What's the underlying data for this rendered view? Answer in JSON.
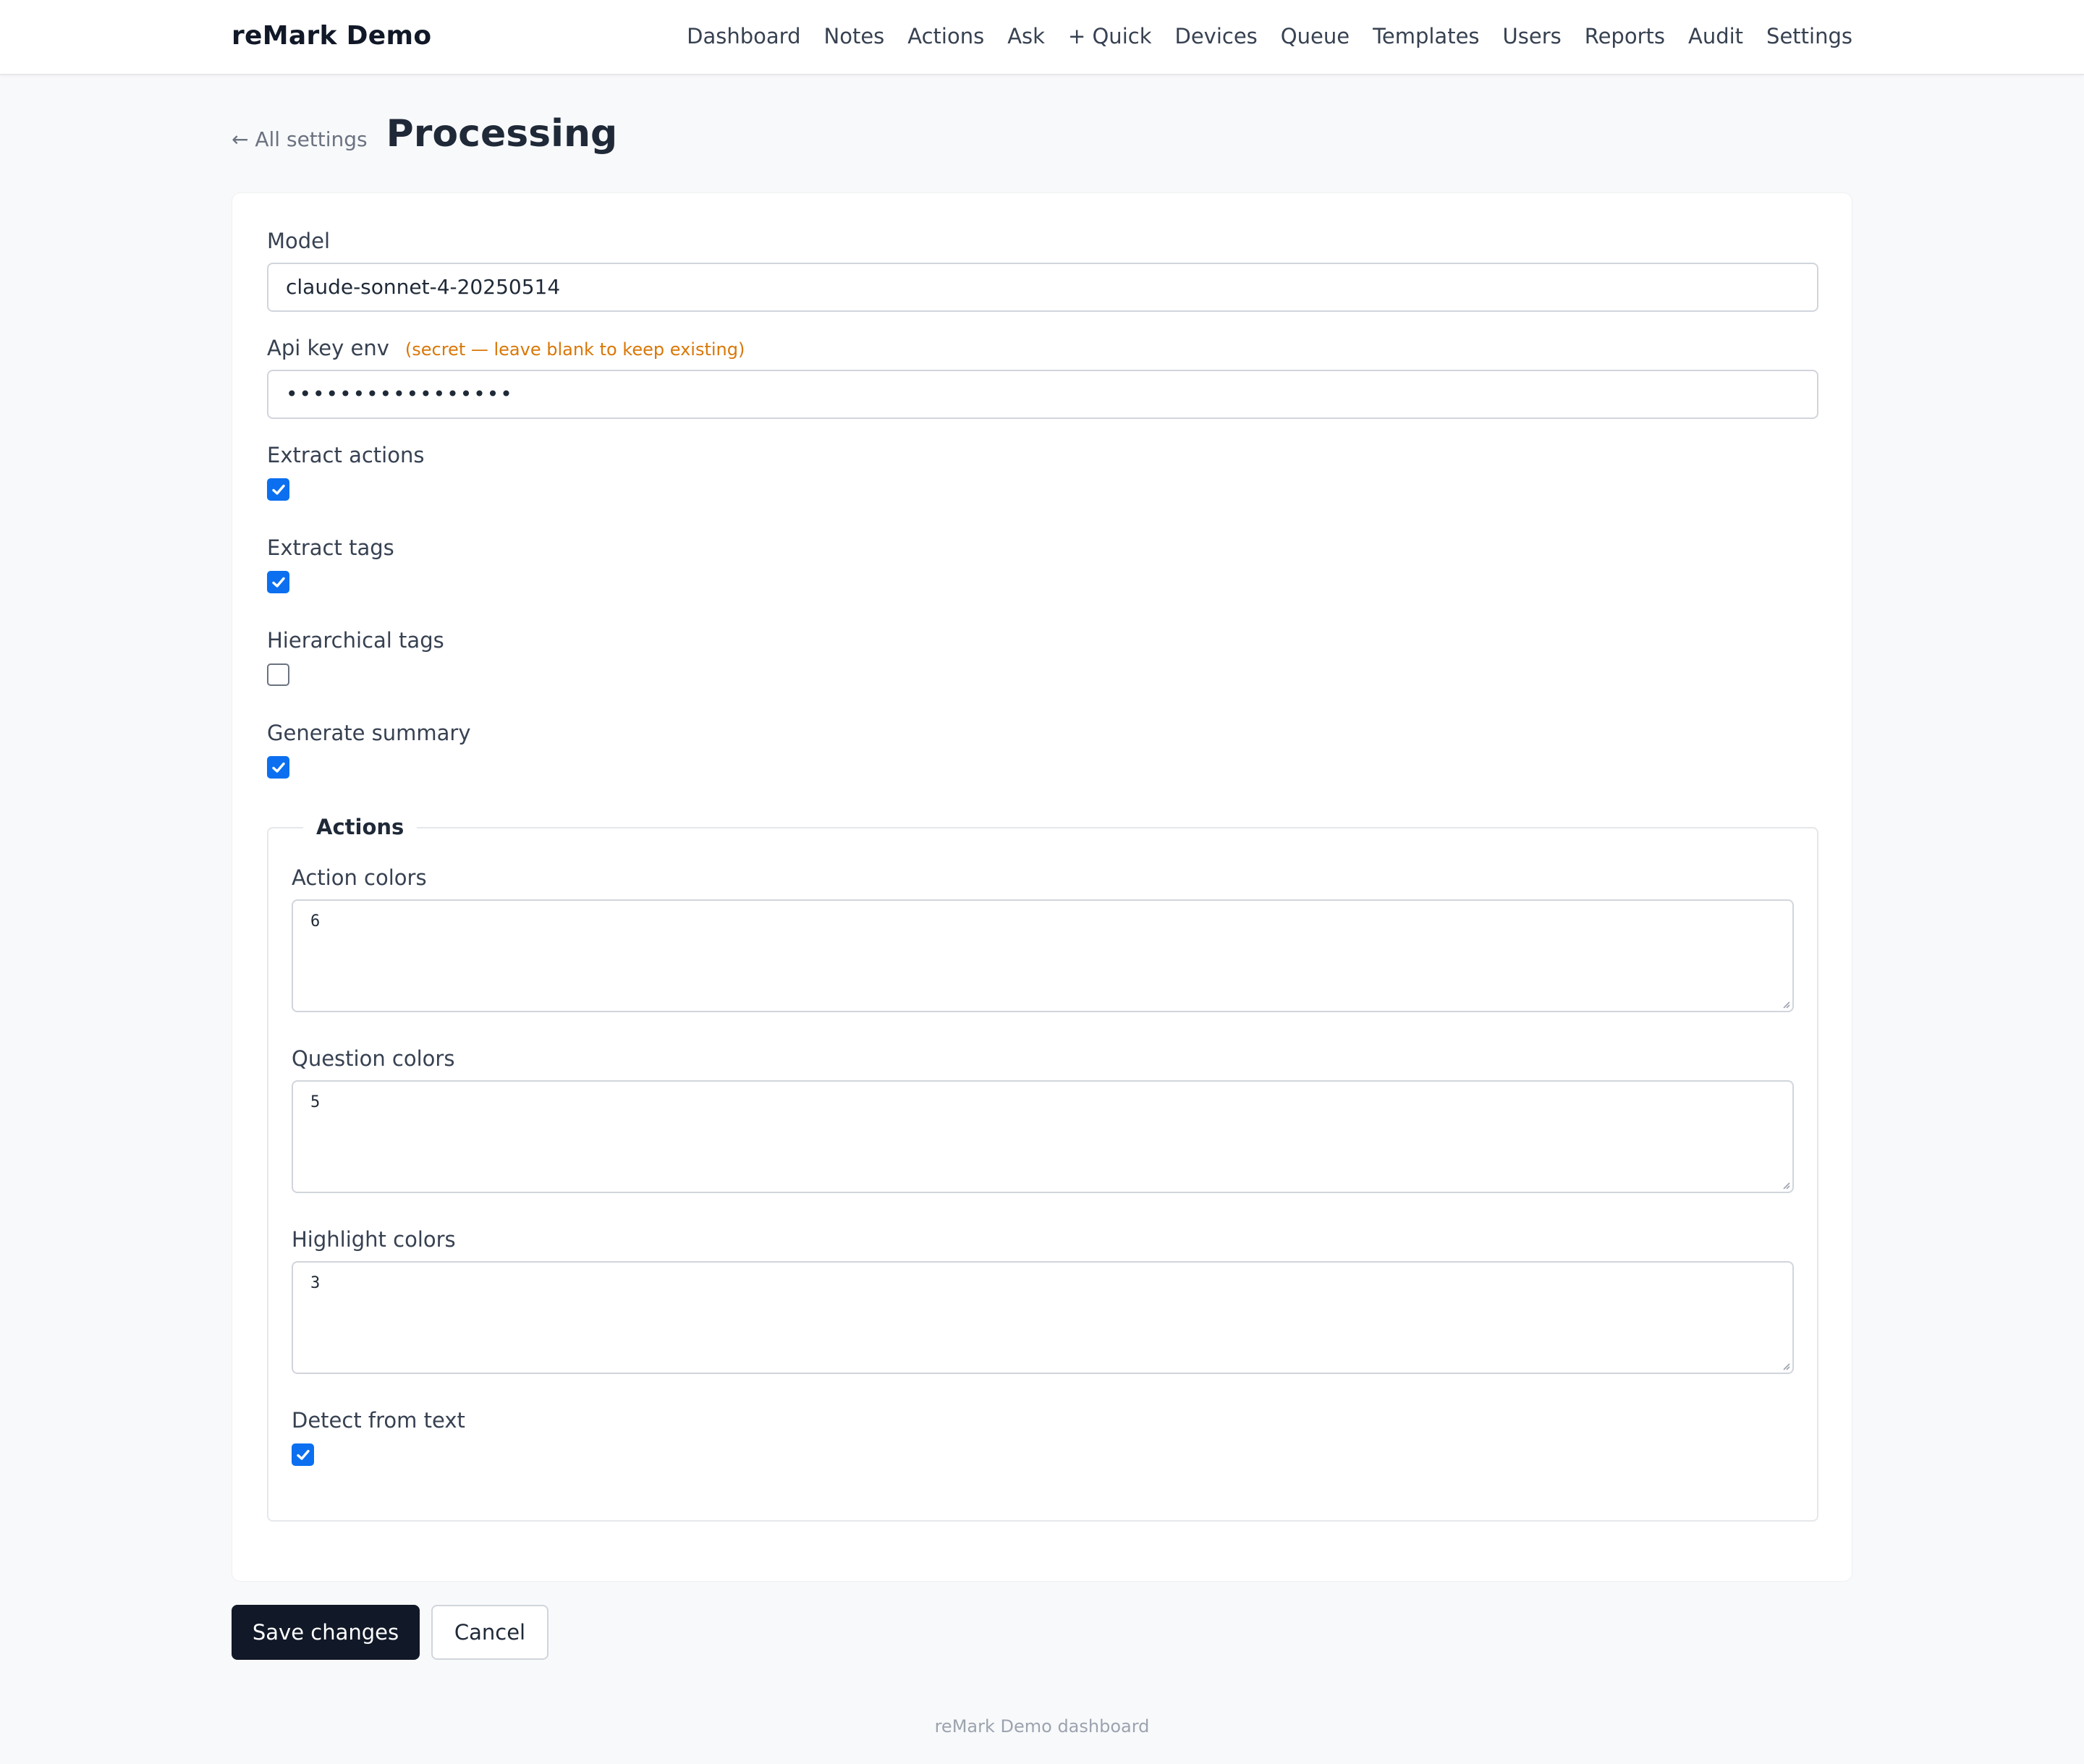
{
  "app": {
    "brand": "reMark Demo"
  },
  "nav": {
    "items": [
      {
        "label": "Dashboard"
      },
      {
        "label": "Notes"
      },
      {
        "label": "Actions"
      },
      {
        "label": "Ask"
      },
      {
        "label": "+ Quick"
      },
      {
        "label": "Devices"
      },
      {
        "label": "Queue"
      },
      {
        "label": "Templates"
      },
      {
        "label": "Users"
      },
      {
        "label": "Reports"
      },
      {
        "label": "Audit"
      },
      {
        "label": "Settings"
      }
    ]
  },
  "header": {
    "back_label": "← All settings",
    "title": "Processing"
  },
  "form": {
    "model": {
      "label": "Model",
      "value": "claude-sonnet-4-20250514"
    },
    "api_key_env": {
      "label": "Api key env",
      "hint": "(secret — leave blank to keep existing)",
      "masked_value": "•••••••••••••••••"
    },
    "extract_actions": {
      "label": "Extract actions",
      "checked": true
    },
    "extract_tags": {
      "label": "Extract tags",
      "checked": true
    },
    "hierarchical_tags": {
      "label": "Hierarchical tags",
      "checked": false
    },
    "generate_summary": {
      "label": "Generate summary",
      "checked": true
    },
    "actions_group": {
      "legend": "Actions",
      "action_colors": {
        "label": "Action colors",
        "value": "6"
      },
      "question_colors": {
        "label": "Question colors",
        "value": "5"
      },
      "highlight_colors": {
        "label": "Highlight colors",
        "value": "3"
      },
      "detect_from_text": {
        "label": "Detect from text",
        "checked": true
      }
    }
  },
  "buttons": {
    "save_label": "Save changes",
    "cancel_label": "Cancel"
  },
  "footer": {
    "text": "reMark Demo dashboard"
  },
  "colors": {
    "accent": "#0b6ff0",
    "primary_button": "#111827",
    "hint": "#d97706"
  }
}
